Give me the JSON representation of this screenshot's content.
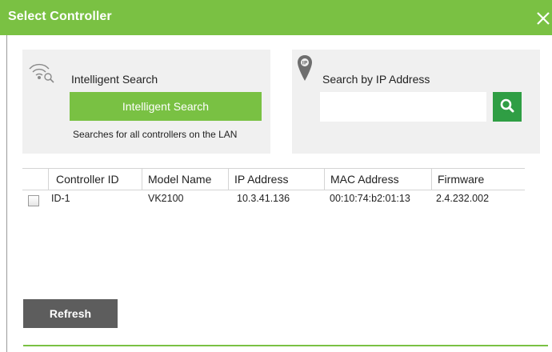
{
  "window": {
    "title": "Select Controller",
    "close_glyph": "✕",
    "accent": "#7ac143"
  },
  "intelligent_search": {
    "icon": "wifi-search-icon",
    "label": "Intelligent Search",
    "button_label": "Intelligent Search",
    "help_text": "Searches for all controllers on the LAN"
  },
  "ip_search": {
    "icon": "location-pin-icon",
    "label": "Search by IP Address",
    "input_value": "",
    "search_icon": "search-icon",
    "button_color": "#2f9e44"
  },
  "table": {
    "columns": [
      "Controller ID",
      "Model Name",
      "IP Address",
      "MAC Address",
      "Firmware"
    ],
    "rows": [
      {
        "checked": false,
        "controller_id": "ID-1",
        "model_name": "VK2100",
        "ip_address": "10.3.41.136",
        "mac_address": "00:10:74:b2:01:13",
        "firmware": "2.4.232.002"
      }
    ]
  },
  "footer": {
    "refresh_label": "Refresh"
  }
}
